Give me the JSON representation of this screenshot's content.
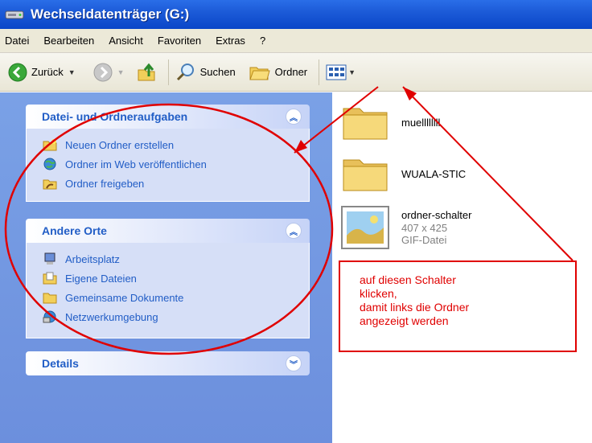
{
  "window": {
    "title": "Wechseldatenträger (G:)"
  },
  "menu": [
    "Datei",
    "Bearbeiten",
    "Ansicht",
    "Favoriten",
    "Extras",
    "?"
  ],
  "toolbar": {
    "back_label": "Zurück",
    "search_label": "Suchen",
    "folders_label": "Ordner"
  },
  "panels": {
    "tasks": {
      "title": "Datei- und Ordneraufgaben",
      "items": [
        "Neuen Ordner erstellen",
        "Ordner im Web veröffentlichen",
        "Ordner freigeben"
      ]
    },
    "other_places": {
      "title": "Andere Orte",
      "items": [
        "Arbeitsplatz",
        "Eigene Dateien",
        "Gemeinsame Dokumente",
        "Netzwerkumgebung"
      ]
    },
    "details": {
      "title": "Details"
    }
  },
  "files": [
    {
      "name": "muellllllll"
    },
    {
      "name": "WUALA-STIC"
    },
    {
      "name": "ordner-schalter",
      "dimensions": "407 x 425",
      "type": "GIF-Datei"
    }
  ],
  "callout": {
    "lines": [
      "auf diesen Schalter",
      "klicken,",
      "damit links die Ordner",
      "angezeigt werden"
    ],
    "color": "#e00000"
  },
  "colors": {
    "title_bar": "#0a46c8",
    "task_link": "#215dc6",
    "task_pane": "#6c8fdd"
  }
}
